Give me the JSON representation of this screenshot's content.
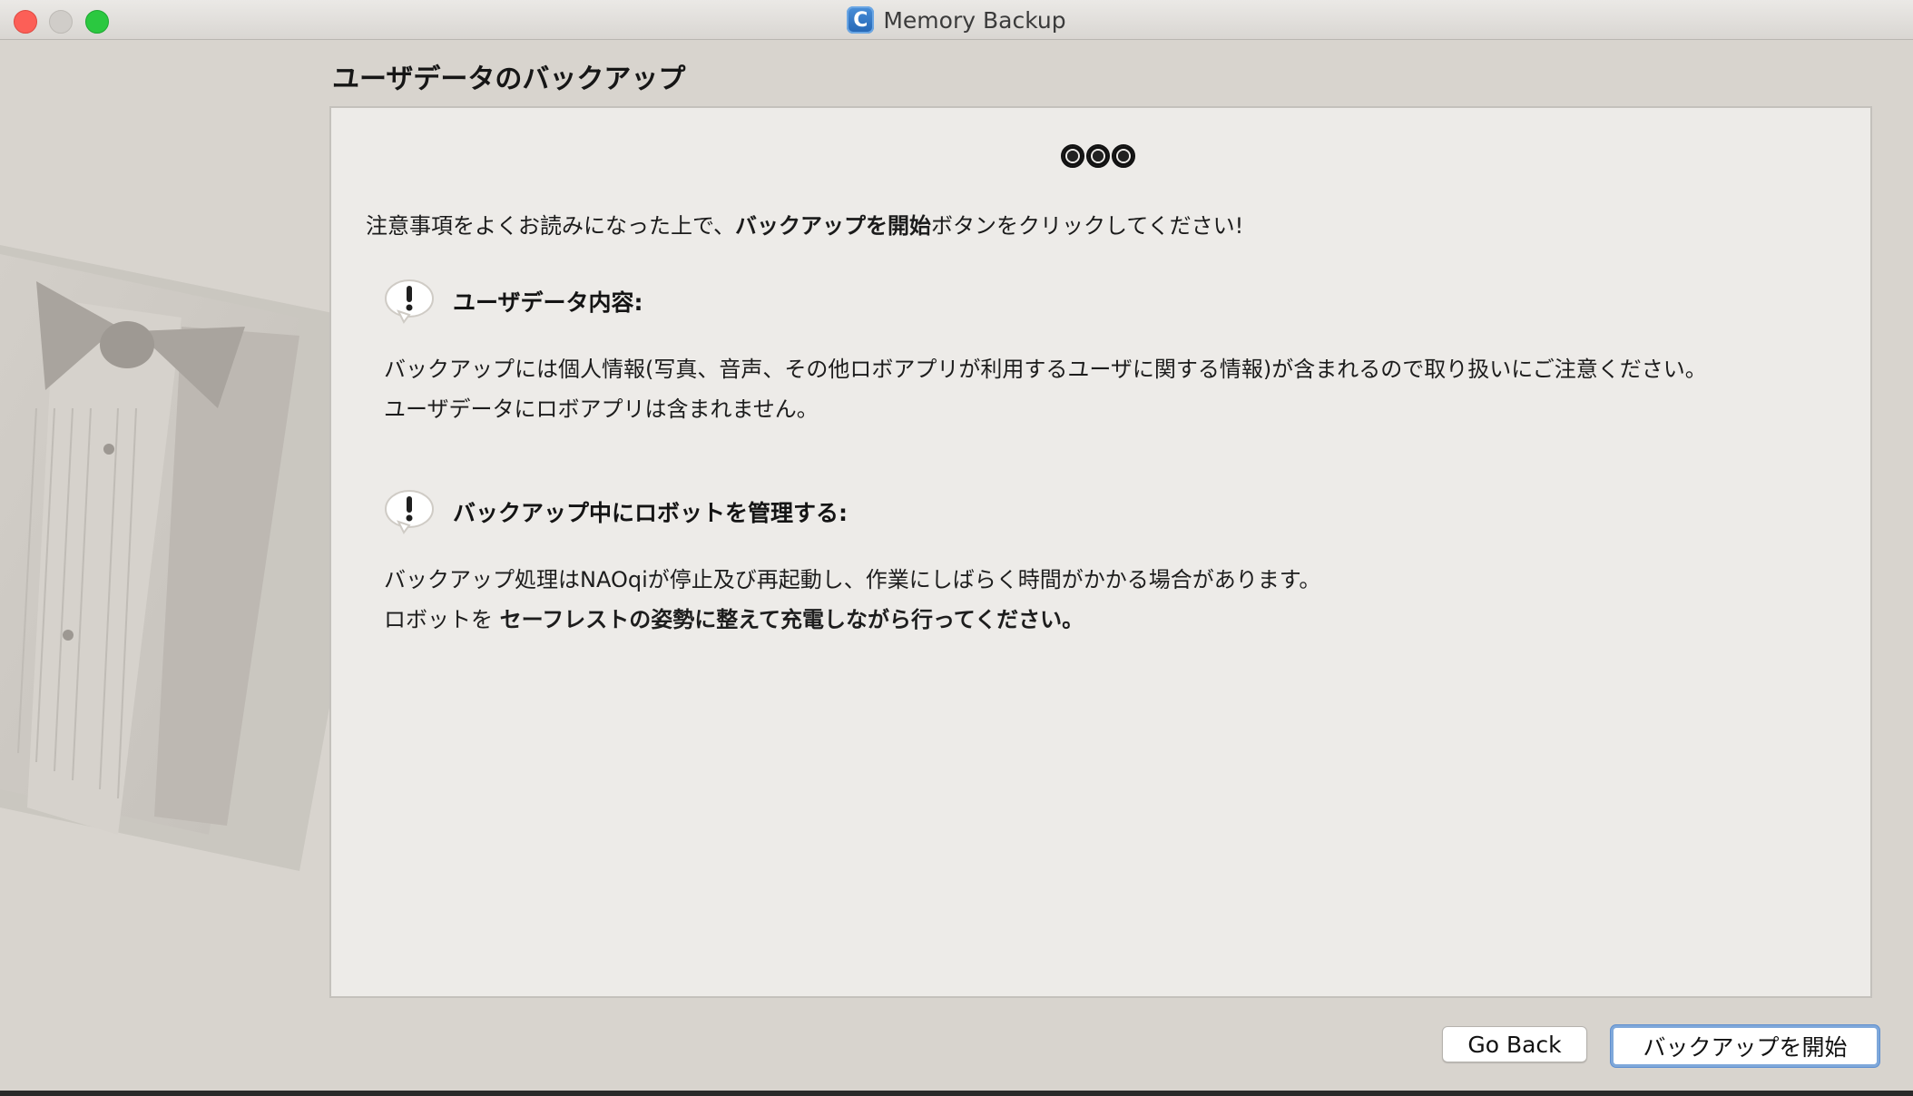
{
  "window": {
    "app_title": "Memory Backup",
    "app_icon_letter": "C"
  },
  "page": {
    "title": "ユーザデータのバックアップ"
  },
  "intro": {
    "before": "注意事項をよくお読みになった上で、",
    "bold": "バックアップを開始",
    "after": "ボタンをクリックしてください!"
  },
  "notes": [
    {
      "title": "ユーザデータ内容:",
      "lines": [
        "バックアップには個人情報(写真、音声、その他ロボアプリが利用するユーザに関する情報)が含まれるので取り扱いにご注意ください。",
        "ユーザデータにロボアプリは含まれません。"
      ]
    },
    {
      "title": "バックアップ中にロボットを管理する:",
      "line1": "バックアップ処理はNAOqiが停止及び再起動し、作業にしばらく時間がかかる場合があります。",
      "line2_prefix": "ロボットを ",
      "line2_bold": "セーフレストの姿勢に整えて充電しながら行ってください。"
    }
  ],
  "buttons": {
    "back_label": "Go Back",
    "start_label": "バックアップを開始"
  },
  "colors": {
    "close": "#fc5f57",
    "minimize": "#d0cdc9",
    "maximize": "#2bc840",
    "panel_bg": "#edebe8",
    "window_bg": "#d8d4ce"
  }
}
